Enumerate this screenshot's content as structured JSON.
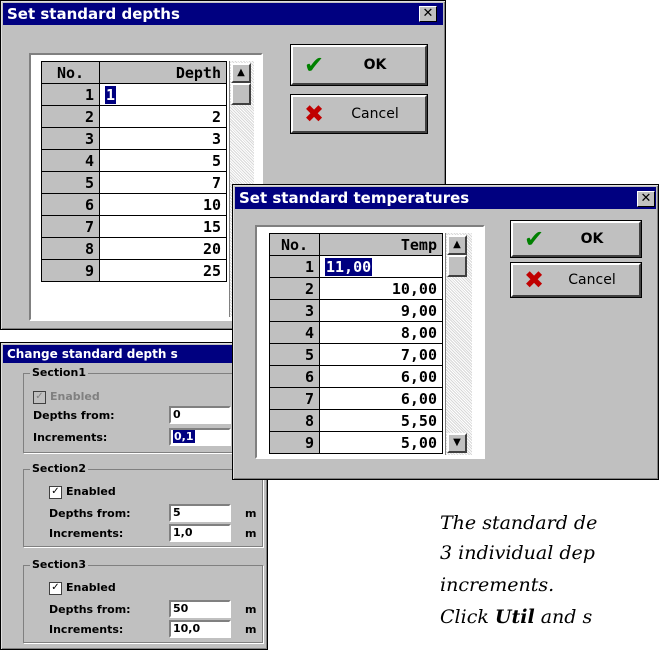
{
  "depths_window": {
    "title": "Set standard depths",
    "col_no": "No.",
    "col_value": "Depth",
    "rows": [
      {
        "no": "1",
        "value": "1"
      },
      {
        "no": "2",
        "value": "2"
      },
      {
        "no": "3",
        "value": "3"
      },
      {
        "no": "4",
        "value": "5"
      },
      {
        "no": "5",
        "value": "7"
      },
      {
        "no": "6",
        "value": "10"
      },
      {
        "no": "7",
        "value": "15"
      },
      {
        "no": "8",
        "value": "20"
      },
      {
        "no": "9",
        "value": "25"
      }
    ],
    "ok_label": "OK",
    "cancel_label": "Cancel"
  },
  "temps_window": {
    "title": "Set standard temperatures",
    "col_no": "No.",
    "col_value": "Temp",
    "rows": [
      {
        "no": "1",
        "value": "11,00"
      },
      {
        "no": "2",
        "value": "10,00"
      },
      {
        "no": "3",
        "value": "9,00"
      },
      {
        "no": "4",
        "value": "8,00"
      },
      {
        "no": "5",
        "value": "7,00"
      },
      {
        "no": "6",
        "value": "6,00"
      },
      {
        "no": "7",
        "value": "6,00"
      },
      {
        "no": "8",
        "value": "5,50"
      },
      {
        "no": "9",
        "value": "5,00"
      }
    ],
    "ok_label": "OK",
    "cancel_label": "Cancel"
  },
  "change_window": {
    "title": "Change standard depth s",
    "sections": [
      {
        "label": "Section1",
        "enabled_label": "Enabled",
        "depths_from_label": "Depths from:",
        "depths_from": "0",
        "increments_label": "Increments:",
        "increments": "0,1",
        "unit": ""
      },
      {
        "label": "Section2",
        "enabled_label": "Enabled",
        "depths_from_label": "Depths from:",
        "depths_from": "5",
        "increments_label": "Increments:",
        "increments": "1,0",
        "unit": "m"
      },
      {
        "label": "Section3",
        "enabled_label": "Enabled",
        "depths_from_label": "Depths from:",
        "depths_from": "50",
        "increments_label": "Increments:",
        "increments": "10,0",
        "unit": "m"
      }
    ]
  },
  "description": {
    "line1": "The standard de",
    "line2": "3 individual dep",
    "line3": "increments.",
    "line4_prefix": "Click ",
    "line4_bold": "Util",
    "line4_suffix": " and s"
  },
  "colors": {
    "titlebar": "#000080",
    "window": "#c0c0c0",
    "ok_check": "#008000",
    "cancel_x": "#c00000"
  },
  "icons": {
    "ok": "checkmark-icon",
    "cancel": "x-icon",
    "close": "close-icon",
    "scroll_up": "arrow-up-icon",
    "scroll_down": "arrow-down-icon"
  }
}
